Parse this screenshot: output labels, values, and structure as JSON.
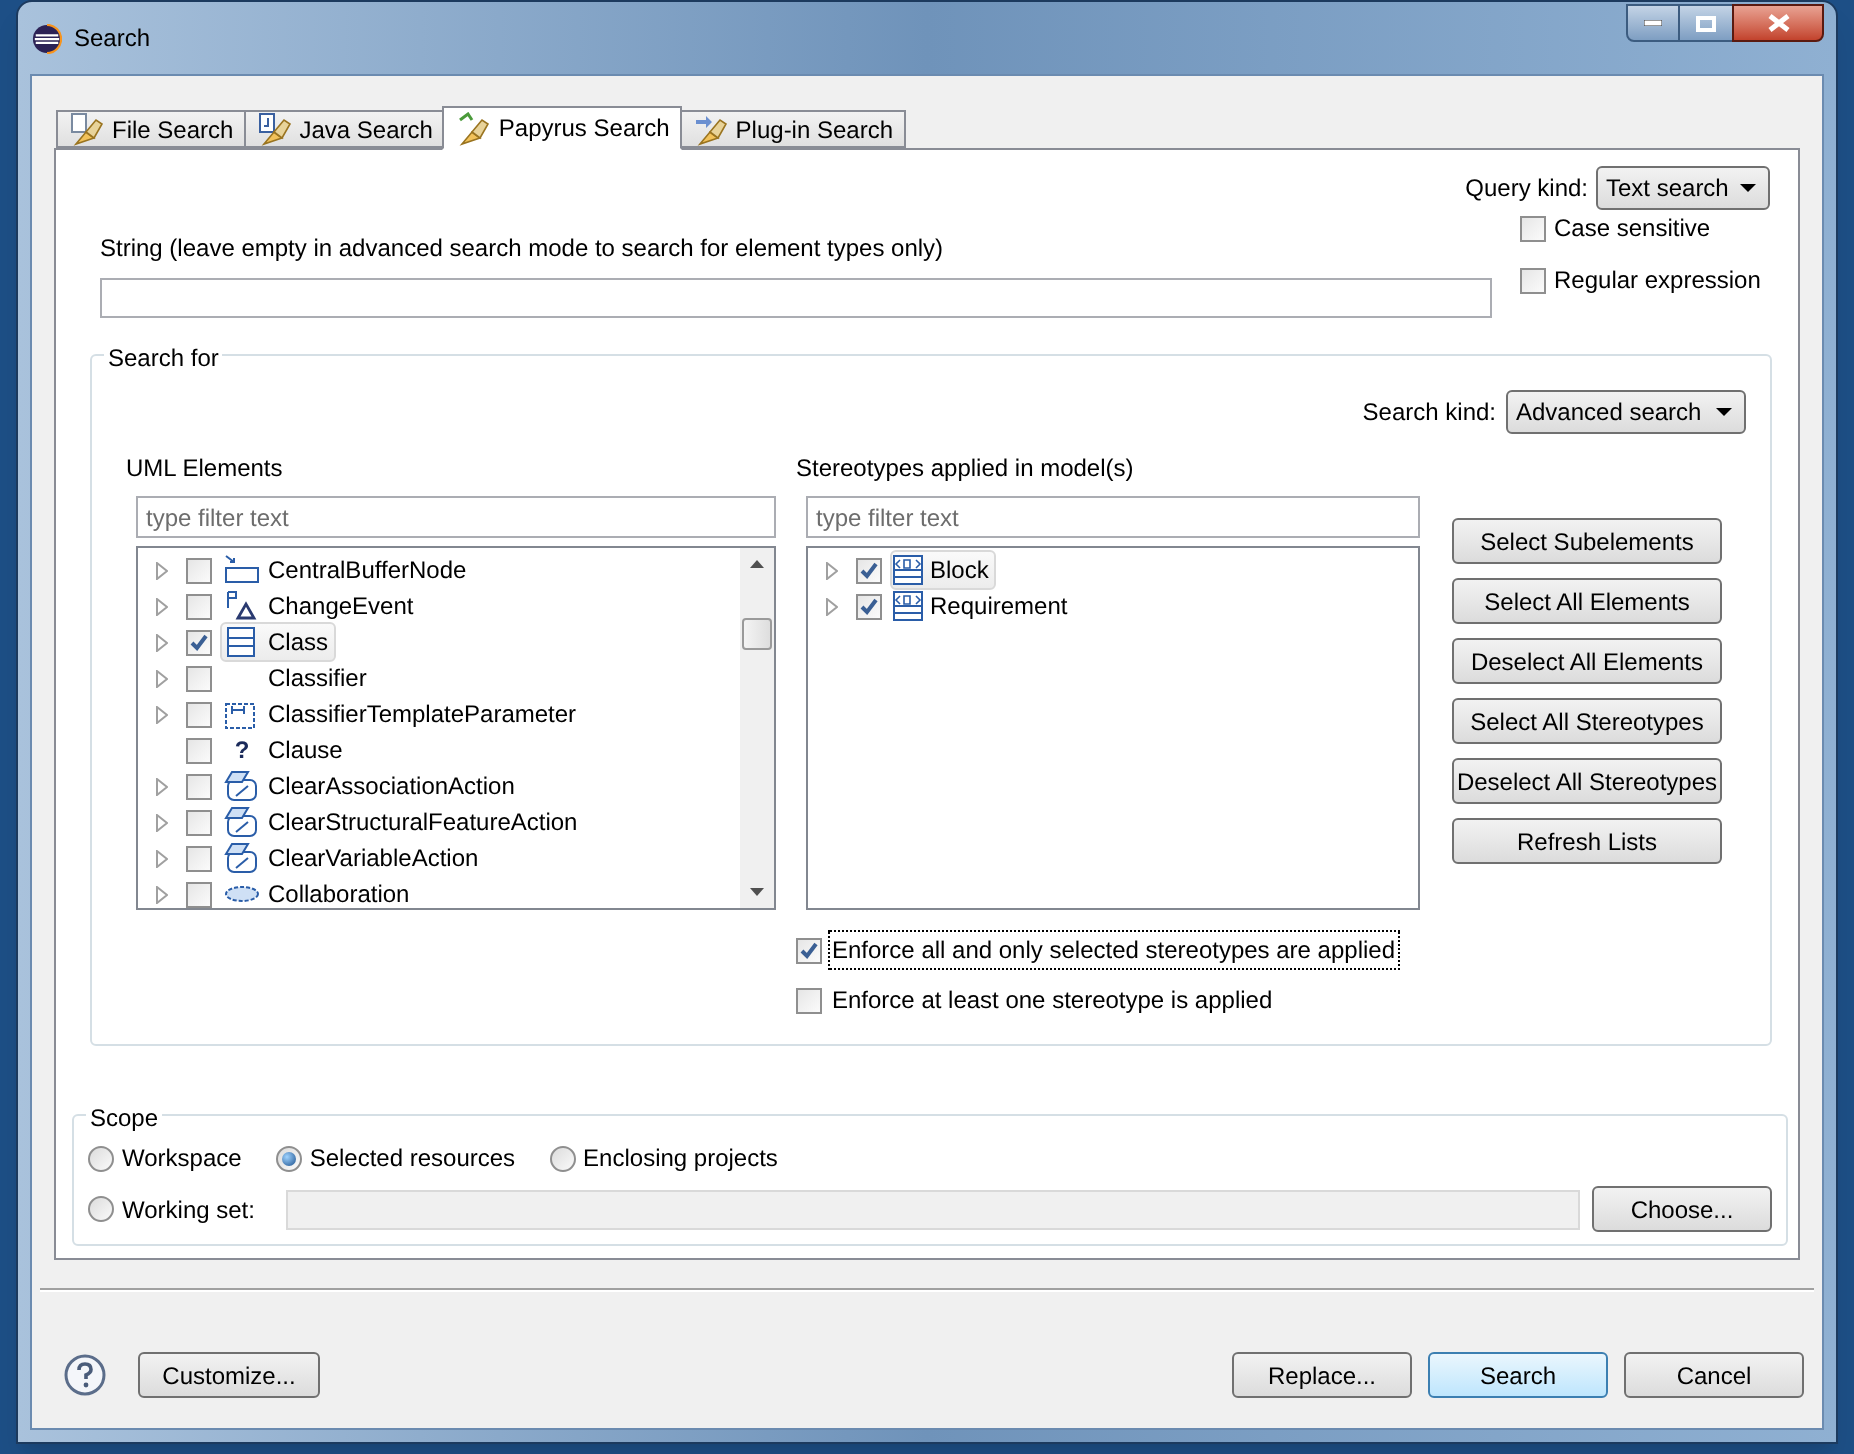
{
  "window": {
    "title": "Search"
  },
  "tabs": [
    {
      "label": "File Search",
      "selected": false,
      "kind": "file"
    },
    {
      "label": "Java Search",
      "selected": false,
      "kind": "java"
    },
    {
      "label": "Papyrus Search",
      "selected": true,
      "kind": "papyrus"
    },
    {
      "label": "Plug-in Search",
      "selected": false,
      "kind": "plugin"
    }
  ],
  "query_kind": {
    "label": "Query kind:",
    "value": "Text search"
  },
  "string_field": {
    "label": "String (leave empty in advanced search mode to search for element types only)"
  },
  "options": [
    {
      "label": "Case sensitive",
      "checked": false
    },
    {
      "label": "Regular expression",
      "checked": false
    }
  ],
  "search_for": {
    "title": "Search for",
    "search_kind": {
      "label": "Search kind:",
      "value": "Advanced search"
    },
    "uml_elements": {
      "title": "UML Elements",
      "filter_placeholder": "type filter text",
      "items": [
        {
          "label": "CentralBufferNode",
          "kind": "buffer",
          "expandable": true,
          "checked": false,
          "selected": false
        },
        {
          "label": "ChangeEvent",
          "kind": "event",
          "expandable": true,
          "checked": false,
          "selected": false
        },
        {
          "label": "Class",
          "kind": "class",
          "expandable": true,
          "checked": true,
          "selected": true
        },
        {
          "label": "Classifier",
          "kind": "none",
          "expandable": true,
          "checked": false,
          "selected": false
        },
        {
          "label": "ClassifierTemplateParameter",
          "kind": "template",
          "expandable": true,
          "checked": false,
          "selected": false
        },
        {
          "label": "Clause",
          "kind": "glyph",
          "glyph": "?",
          "expandable": false,
          "checked": false,
          "selected": false
        },
        {
          "label": "ClearAssociationAction",
          "kind": "clear",
          "expandable": true,
          "checked": false,
          "selected": false
        },
        {
          "label": "ClearStructuralFeatureAction",
          "kind": "clear",
          "expandable": true,
          "checked": false,
          "selected": false
        },
        {
          "label": "ClearVariableAction",
          "kind": "clear",
          "expandable": true,
          "checked": false,
          "selected": false
        },
        {
          "label": "Collaboration",
          "kind": "collaboration",
          "expandable": true,
          "checked": false,
          "selected": false
        }
      ]
    },
    "stereotypes": {
      "title": "Stereotypes applied in model(s)",
      "filter_placeholder": "type filter text",
      "items": [
        {
          "label": "Block",
          "kind": "stereotype",
          "expandable": true,
          "checked": true,
          "selected": true
        },
        {
          "label": "Requirement",
          "kind": "stereotype",
          "expandable": true,
          "checked": true,
          "selected": false
        }
      ]
    },
    "buttons": [
      "Select Subelements",
      "Select All Elements",
      "Deselect All Elements",
      "Select All Stereotypes",
      "Deselect All Stereotypes",
      "Refresh Lists"
    ],
    "enforce": [
      {
        "label": "Enforce all and only selected stereotypes are applied",
        "checked": true,
        "focused": true
      },
      {
        "label": "Enforce at least one stereotype is applied",
        "checked": false,
        "focused": false
      }
    ]
  },
  "scope": {
    "title": "Scope",
    "options": [
      {
        "label": "Workspace",
        "selected": false
      },
      {
        "label": "Selected resources",
        "selected": true
      },
      {
        "label": "Enclosing projects",
        "selected": false
      }
    ],
    "working_set": {
      "label": "Working set:",
      "selected": false
    },
    "choose_button": "Choose..."
  },
  "footer": {
    "customize": "Customize...",
    "buttons": [
      {
        "label": "Replace...",
        "default": false
      },
      {
        "label": "Search",
        "default": true
      },
      {
        "label": "Cancel",
        "default": false
      }
    ]
  }
}
